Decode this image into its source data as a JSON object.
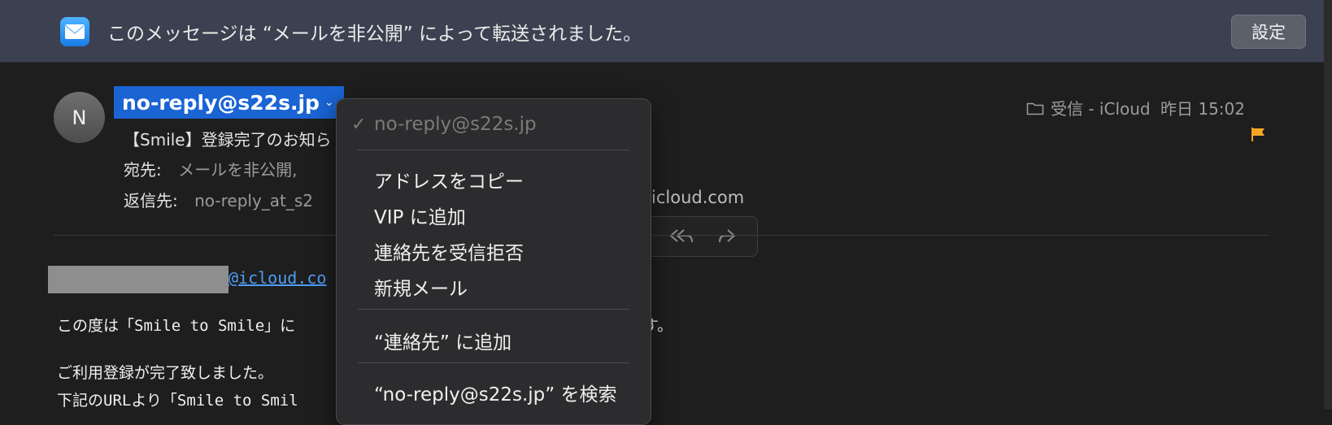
{
  "banner": {
    "text": "このメッセージは “メールを非公開” によって転送されました。",
    "button": "設定"
  },
  "header": {
    "avatar_initial": "N",
    "sender": "no-reply@s22s.jp",
    "subject": "【Smile】登録完了のお知ら",
    "to_label": "宛先:",
    "to_value": "メールを非公開,",
    "reply_label": "返信先:",
    "reply_value": "no-reply_at_s2",
    "reply_value_tail": "@icloud.com",
    "mailbox": "受信 - iCloud",
    "date": "昨日 15:02"
  },
  "body": {
    "email_link": "@icloud.co",
    "line1": "この度は「Smile to Smile」に",
    "line1_tail": "す。",
    "line2": "ご利用登録が完了致しました。",
    "line3": "下記のURLより「Smile to Smil"
  },
  "menu": {
    "selected": "no-reply@s22s.jp",
    "copy": "アドレスをコピー",
    "vip": "VIP に追加",
    "block": "連絡先を受信拒否",
    "new_mail": "新規メール",
    "add_contacts": "“連絡先” に追加",
    "search": "“no-reply@s22s.jp” を検索"
  },
  "colors": {
    "accent": "#1a64d4",
    "link": "#4e9df5",
    "flag": "#f5a623",
    "banner": "#3b4150"
  }
}
